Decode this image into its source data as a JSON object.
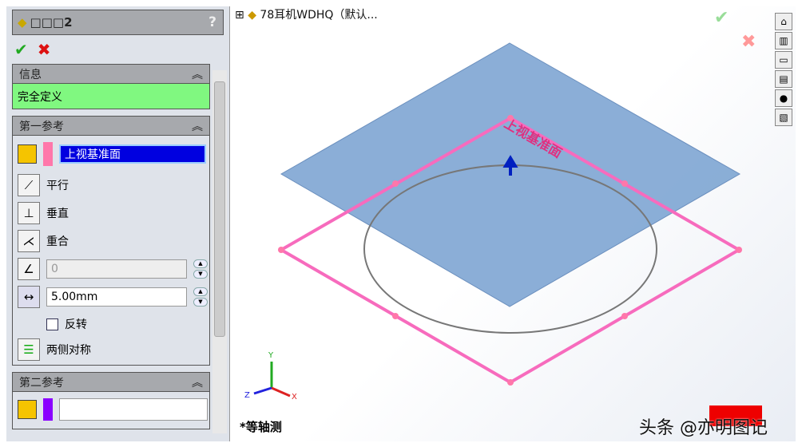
{
  "panel": {
    "title": "□□□2",
    "help": "?",
    "ok": "✔",
    "cancel": "✖",
    "info": {
      "header": "信息",
      "status": "完全定义",
      "status_color": "#80f880"
    },
    "first_ref": {
      "header": "第一参考",
      "selection": "上视基准面",
      "parallel": "平行",
      "perpendicular": "垂直",
      "coincident": "重合",
      "angle_value": "0",
      "offset_value": "5.00mm",
      "flip": "反转",
      "symmetric": "两侧对称"
    },
    "second_ref": {
      "header": "第二参考",
      "selection": ""
    }
  },
  "viewport": {
    "tree_item": "78耳机WDHQ（默认...",
    "plane_label": "上视基准面",
    "view_name": "*等轴测",
    "axes": {
      "x": "X",
      "y": "Y",
      "z": "Z"
    }
  },
  "watermark": "头条 @亦明图记"
}
